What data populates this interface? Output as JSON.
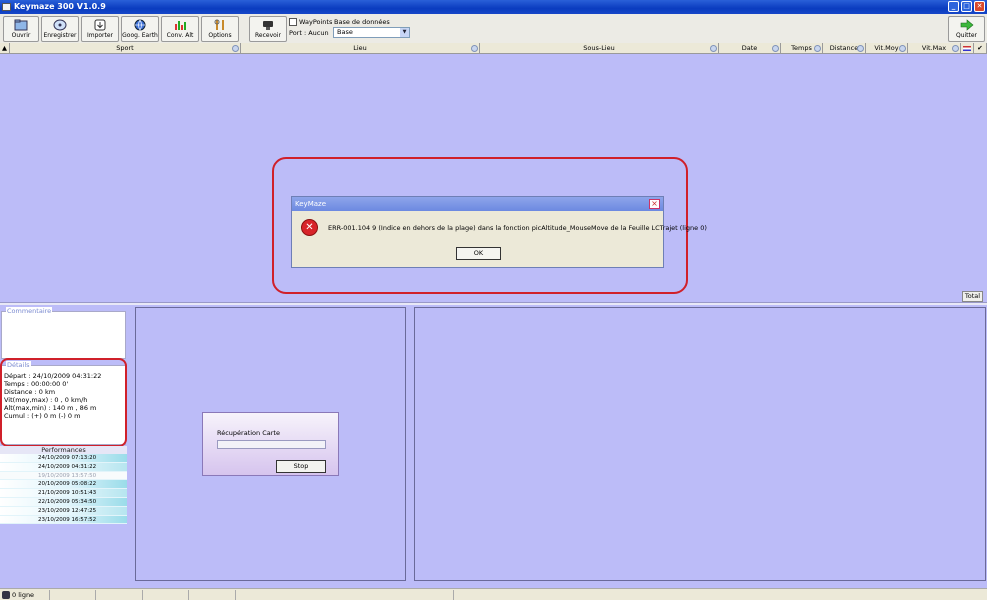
{
  "window": {
    "title": "Keymaze 300 V1.0.9"
  },
  "toolbar": {
    "ouvrir": "Ouvrir",
    "enregistrer": "Enregistrer",
    "importer": "Importer",
    "google_earth": "Goog. Earth",
    "conv_alt": "Conv. Alt",
    "options": "Options",
    "recevoir": "Recevoir",
    "quitter": "Quitter",
    "waypoints_label": "WayPoints",
    "base_label": "Base de données",
    "port_label": "Port : Aucun",
    "base_value": "Base"
  },
  "table": {
    "columns": [
      "Sport",
      "Lieu",
      "Sous-Lieu",
      "Date",
      "Temps",
      "Distance",
      "Vit.Moy",
      "Vit.Max"
    ]
  },
  "dialog": {
    "title": "KeyMaze",
    "message": "ERR-001.104 9 (Indice en dehors de la plage) dans la fonction picAltitude_MouseMove de la Feuille LCTrajet (ligne 0)",
    "ok": "OK"
  },
  "total_label": "Total",
  "commentaire_label": "Commentaire",
  "details": {
    "label": "Détails",
    "depart": "Départ : 24/10/2009 04:31:22",
    "temps": "Temps : 00:00:00 0'",
    "distance": "Distance : 0 km",
    "vit": "Vit(moy,max) : 0 , 0 km/h",
    "alt": "Alt(max,min) : 140 m , 86 m",
    "cumul": "Cumul : (+) 0 m (-) 0 m"
  },
  "performances": {
    "label": "Performances",
    "rows": [
      "24/10/2009 07:13:20",
      "24/10/2009 04:31:22",
      "19/10/2009 13:57:50",
      "20/10/2009 05:08:22",
      "21/10/2009 10:51:43",
      "22/10/2009 05:34:50",
      "23/10/2009 12:47:25",
      "23/10/2009 16:57:52"
    ]
  },
  "recuperation": {
    "title": "Récupération Carte",
    "stop": "Stop"
  },
  "status": {
    "lines": "0 ligne"
  }
}
